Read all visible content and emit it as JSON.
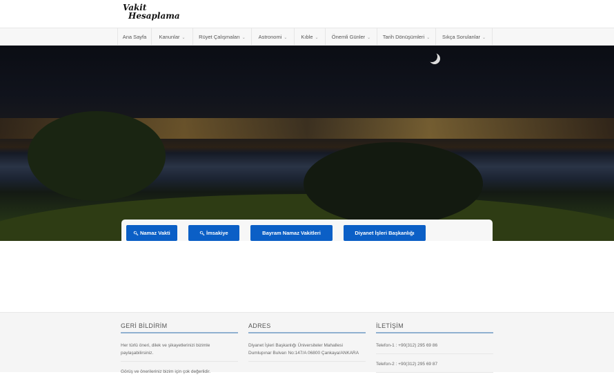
{
  "header": {
    "logo_line1": "Vakit",
    "logo_line2": "Hesaplama"
  },
  "nav": {
    "items": [
      {
        "label": "Ana Sayfa",
        "dropdown": false
      },
      {
        "label": "Kanunlar",
        "dropdown": true
      },
      {
        "label": "Rüyet Çalışmaları",
        "dropdown": true
      },
      {
        "label": "Astronomi",
        "dropdown": true
      },
      {
        "label": "Kıble",
        "dropdown": true
      },
      {
        "label": "Önemli Günler",
        "dropdown": true
      },
      {
        "label": "Tarih Dönüşümleri",
        "dropdown": true
      },
      {
        "label": "Sıkça Sorulanlar",
        "dropdown": true
      }
    ],
    "chevron": "⌄"
  },
  "quick_links": [
    {
      "label": "Namaz Vakti",
      "icon": "search-icon",
      "glyph": "🔍︎"
    },
    {
      "label": "İmsakiye",
      "icon": "search-icon",
      "glyph": "🔍︎"
    },
    {
      "label": "Bayram Namaz Vakitleri"
    },
    {
      "label": "Diyanet İşleri Başkanlığı"
    }
  ],
  "footer": {
    "feedback": {
      "title": "GERİ BİLDİRİM",
      "text1": "Her türlü öneri, dilek ve şikayetlerinizi bizimle paylaşabilirsiniz.",
      "text2": "Görüş ve önerileriniz bizim için çok değerlidir."
    },
    "address": {
      "title": "ADRES",
      "text": "Diyanet İşleri Başkanlığı Üniversiteler Mahallesi Dumlupınar Bulvarı No:147/A 06800 Çankaya/ANKARA"
    },
    "contact": {
      "title": "İLETİŞİM",
      "phone1": "Telefon-1 : +90(312) 295 69 86",
      "phone2": "Telefon-2 : +90(312) 295 69 87"
    }
  },
  "colors": {
    "button": "#0b5fc6",
    "footer_rule": "#8fb0d0"
  }
}
